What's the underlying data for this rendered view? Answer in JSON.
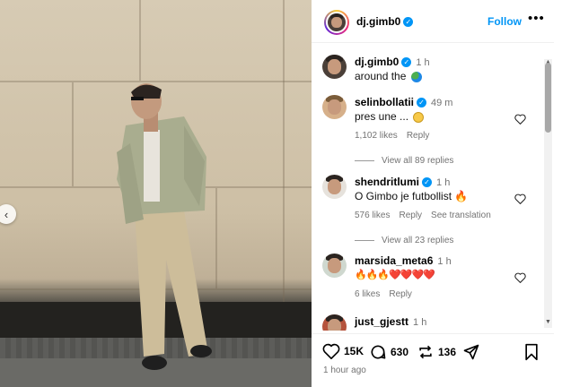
{
  "post": {
    "author": "dj.gimb0",
    "follow_label": "Follow",
    "more_label": "•••",
    "caption_author": "dj.gimb0",
    "caption_time": "1 h",
    "caption_text": "around the"
  },
  "comments": [
    {
      "username": "selinbollatii",
      "time": "49 m",
      "text": "pres une ...",
      "likes": "1,102 likes",
      "reply": "Reply",
      "view_replies": "View all 89 replies"
    },
    {
      "username": "shendritlumi",
      "time": "1 h",
      "text": "O Gimbo je futbollist",
      "likes": "576 likes",
      "reply": "Reply",
      "translate": "See translation",
      "view_replies": "View all 23 replies"
    },
    {
      "username": "marsida_meta6",
      "time": "1 h",
      "text": "🔥🔥🔥❤️❤️❤️❤️",
      "likes": "6 likes",
      "reply": "Reply"
    },
    {
      "username": "just_gjestt",
      "time": "1 h",
      "text": ""
    }
  ],
  "actions": {
    "likes_count": "15K",
    "comments_count": "630",
    "reposts_count": "136",
    "posted_ago": "1 hour ago"
  },
  "icons": {
    "like": "heart-icon",
    "comment": "comment-icon",
    "repost": "repost-icon",
    "share": "share-icon",
    "save": "bookmark-icon",
    "prev": "chevron-left-icon"
  },
  "colors": {
    "accent": "#0095f6",
    "muted": "#737373"
  }
}
